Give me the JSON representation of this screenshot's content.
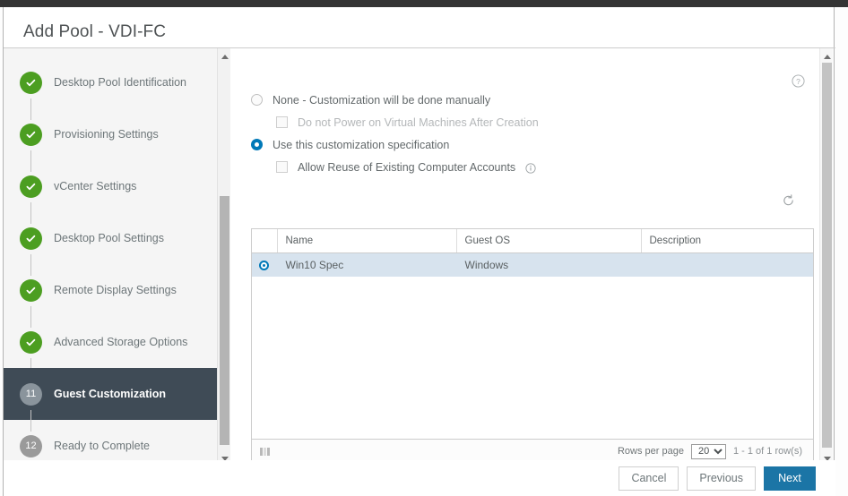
{
  "os_bar": {
    "text": ""
  },
  "window": {
    "title": "Add Pool - VDI-FC"
  },
  "sidebar": {
    "steps": [
      {
        "label": "Desktop Pool Identification",
        "state": "done",
        "badge": ""
      },
      {
        "label": "Provisioning Settings",
        "state": "done",
        "badge": ""
      },
      {
        "label": "vCenter Settings",
        "state": "done",
        "badge": ""
      },
      {
        "label": "Desktop Pool Settings",
        "state": "done",
        "badge": ""
      },
      {
        "label": "Remote Display Settings",
        "state": "done",
        "badge": ""
      },
      {
        "label": "Advanced Storage Options",
        "state": "done",
        "badge": ""
      },
      {
        "label": "Guest Customization",
        "state": "active",
        "badge": "11"
      },
      {
        "label": "Ready to Complete",
        "state": "pending",
        "badge": "12"
      }
    ]
  },
  "main": {
    "help_icon": "help-circle-icon",
    "refresh_icon": "refresh-icon",
    "options": [
      {
        "type": "radio",
        "label": "None - Customization will be done manually",
        "checked": false,
        "indent": false,
        "disabled": false,
        "info": false
      },
      {
        "type": "checkbox",
        "label": "Do not Power on Virtual Machines After Creation",
        "checked": false,
        "indent": true,
        "disabled": true,
        "info": false
      },
      {
        "type": "radio",
        "label": "Use this customization specification",
        "checked": true,
        "indent": false,
        "disabled": false,
        "info": false
      },
      {
        "type": "checkbox",
        "label": "Allow Reuse of Existing Computer Accounts",
        "checked": false,
        "indent": true,
        "disabled": false,
        "info": true
      }
    ],
    "table": {
      "columns": [
        "Name",
        "Guest OS",
        "Description"
      ],
      "rows": [
        {
          "selected": true,
          "name": "Win10 Spec",
          "guest_os": "Windows",
          "description": ""
        }
      ],
      "footer": {
        "columns_icon": "columns-settings-icon",
        "rows_per_page_label": "Rows per page",
        "rows_per_page_value": "20",
        "rows_per_page_options": [
          "20"
        ],
        "range_label": "1 - 1 of 1 row(s)"
      }
    }
  },
  "footer": {
    "cancel": "Cancel",
    "previous": "Previous",
    "next": "Next"
  },
  "colors": {
    "accent": "#0079b8",
    "primary_button": "#1b75a6",
    "step_done": "#4c9e21",
    "active_step_bg": "#3f4b56",
    "row_selected_bg": "#d7e3ee"
  }
}
